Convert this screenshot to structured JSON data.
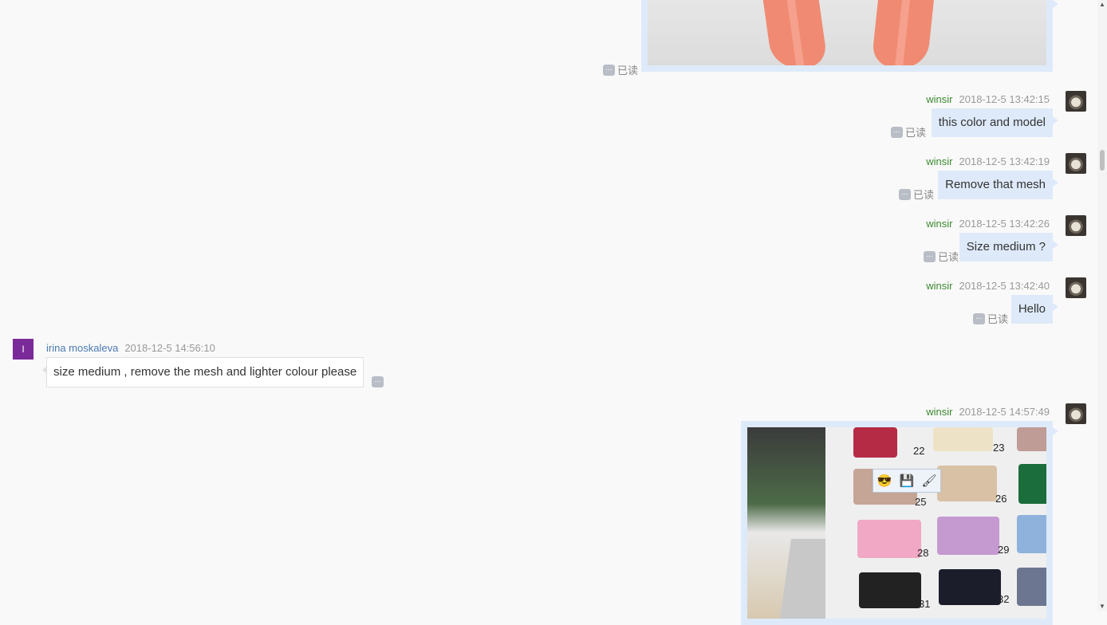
{
  "messages_out": [
    {
      "sender": "winsir",
      "time": "2018-12-5 13:42:15",
      "text": "this color and model",
      "read": "已读"
    },
    {
      "sender": "winsir",
      "time": "2018-12-5 13:42:19",
      "text": "Remove that mesh",
      "read": "已读"
    },
    {
      "sender": "winsir",
      "time": "2018-12-5 13:42:26",
      "text": "Size medium ?",
      "read": "已读"
    },
    {
      "sender": "winsir",
      "time": "2018-12-5 13:42:40",
      "text": "Hello",
      "read": "已读"
    }
  ],
  "top_image": {
    "read": "已读"
  },
  "incoming": {
    "avatar_letter": "I",
    "sender": "irina moskaleva",
    "time": "2018-12-5 14:56:10",
    "text": "size medium , remove the mesh and lighter colour please"
  },
  "last_image": {
    "sender": "winsir",
    "time": "2018-12-5 14:57:49"
  },
  "swatch_numbers": [
    "22",
    "23",
    "25",
    "26",
    "28",
    "29",
    "31",
    "32"
  ],
  "more_glyph": "...",
  "icons": {
    "toolbar": [
      "emoji-add-icon",
      "save-icon",
      "brush-icon"
    ]
  },
  "colors": {
    "accent_out": "#deeaf9",
    "sender_out": "#3c8a2f",
    "sender_in": "#4a7ab5"
  }
}
